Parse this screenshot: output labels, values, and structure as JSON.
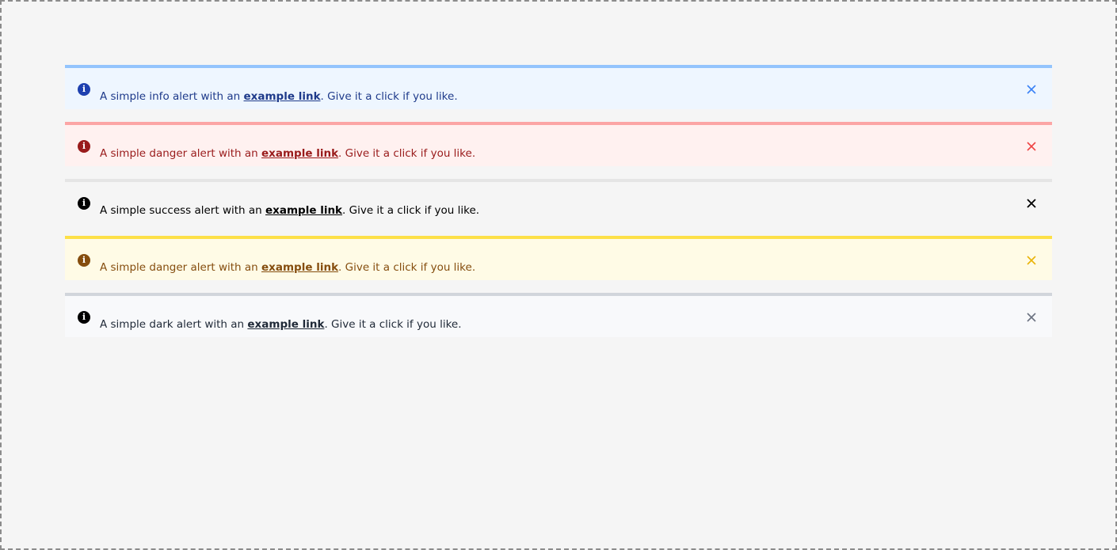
{
  "alerts": [
    {
      "variant": "info",
      "icon": "info-circle-icon",
      "prefix": "A simple info alert with an ",
      "link": "example link",
      "suffix": ". Give it a click if you like.",
      "close_color": "#3b82f6"
    },
    {
      "variant": "danger",
      "icon": "info-circle-icon",
      "prefix": "A simple danger alert with an ",
      "link": "example link",
      "suffix": ". Give it a click if you like.",
      "close_color": "#ef4444"
    },
    {
      "variant": "success",
      "icon": "info-circle-icon",
      "prefix": "A simple success alert with an ",
      "link": "example link",
      "suffix": ". Give it a click if you like.",
      "close_color": "#000000"
    },
    {
      "variant": "warning",
      "icon": "info-circle-icon",
      "prefix": "A simple danger alert with an ",
      "link": "example link",
      "suffix": ". Give it a click if you like.",
      "close_color": "#eab308"
    },
    {
      "variant": "dark",
      "icon": "info-circle-icon",
      "prefix": "A simple dark alert with an ",
      "link": "example link",
      "suffix": ". Give it a click if you like.",
      "close_color": "#6b7280"
    }
  ]
}
